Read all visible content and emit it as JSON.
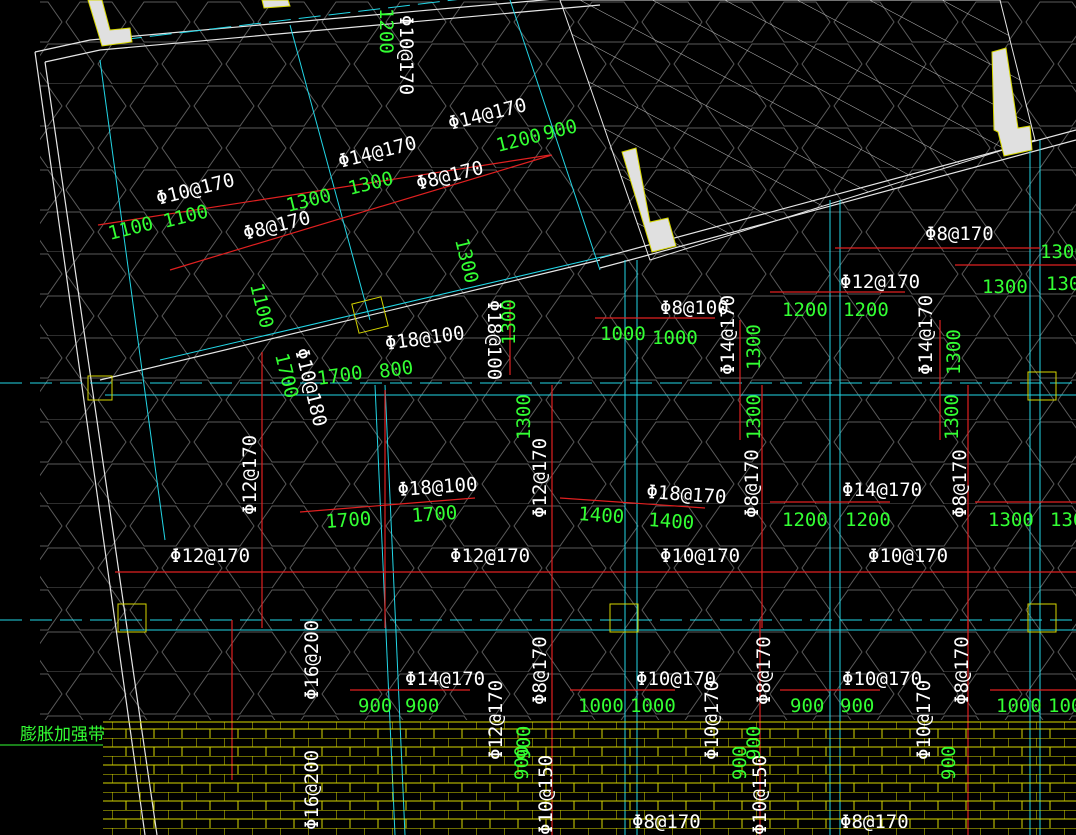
{
  "drawing": {
    "background": "#000000",
    "colors": {
      "rebar_line": "#e02020",
      "axis_cyan": "#22d6e6",
      "outline_white": "#e6e6e6",
      "hex_gray": "#5a5a5a",
      "dim_green": "#33ff33",
      "brick_yellow": "#d6d600",
      "column_fill": "#e0e0e0"
    },
    "note_label": "膨胀加强带",
    "top_labels": [
      "Φ10@170",
      "1200",
      "Φ14@170",
      "1200",
      "900",
      "Φ14@170",
      "Φ8@170",
      "1300",
      "1300",
      "Φ10@170",
      "1100",
      "1100",
      "Φ8@170",
      "1300",
      "1100",
      "Φ8@170",
      "1300",
      "1300"
    ],
    "middle_labels": [
      "Φ8@100",
      "1000",
      "1000",
      "Φ14@170",
      "1300",
      "1200",
      "1200",
      "Φ12@170",
      "Φ14@170",
      "1300",
      "1300",
      "1300",
      "Φ18@100",
      "1700",
      "800",
      "Φ10@180",
      "1700",
      "Φ18@100",
      "1300",
      "Φ12@170",
      "Φ18@100",
      "1700",
      "1700",
      "Φ12@170",
      "Φ18@170",
      "1400",
      "1400",
      "1300",
      "Φ8@170",
      "Φ14@170",
      "1200",
      "1200",
      "Φ8@170",
      "1300",
      "1300",
      "1300"
    ],
    "row_labels": [
      "Φ12@170",
      "Φ12@170",
      "Φ10@170",
      "Φ10@170"
    ],
    "bottom_labels": [
      "Φ16@200",
      "Φ14@170",
      "900",
      "900",
      "Φ12@170",
      "Φ8@170",
      "Φ10@150",
      "900",
      "Φ10@170",
      "1000",
      "1000",
      "Φ10@170",
      "Φ8@170",
      "900",
      "Φ10@150",
      "900",
      "Φ10@170",
      "900",
      "900",
      "Φ10@170",
      "Φ8@170",
      "1000",
      "1000",
      "900",
      "Φ16@200",
      "Φ8@170",
      "Φ8@170",
      "900"
    ]
  }
}
